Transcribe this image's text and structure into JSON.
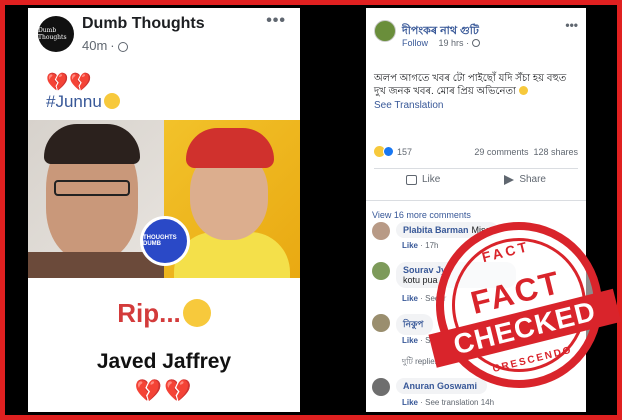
{
  "left_post": {
    "page_name": "Dumb Thoughts",
    "avatar_text": "Dumb Thoughts",
    "time": "40m",
    "more": "•••",
    "emoji_hearts": "💔💔",
    "hashtag": "#Junnu",
    "image_logo_text": "THOUGHTS DUMB",
    "rip_text": "Rip...",
    "person_name": "Javed Jaffrey",
    "bottom_hearts": "💔💔"
  },
  "right_post": {
    "author": "দীপংকৰ নাথ গুটি",
    "follow": "Follow",
    "time": "19 hrs",
    "more": "•••",
    "text": "অলপ আগতে খবৰ টো পাইছোঁ যদি সঁচা হয় বহুত দুখ জনক খবৰ. মোৰ প্ৰিয় অভিনেতা",
    "see_translation": "See Translation",
    "reaction_count": "157",
    "comments_count": "29 comments",
    "shares_count": "128 shares",
    "like_label": "Like",
    "share_label": "Share",
    "view_more": "View 16 more comments",
    "comments": [
      {
        "name": "Plabita Barman",
        "text": "Misa",
        "meta_action": "Like",
        "meta_time": "17h"
      },
      {
        "name": "Sourav Jyo",
        "text": "kotu pua n",
        "meta_action": "Like",
        "meta_extra": "See tr"
      },
      {
        "name": "নিকুপ",
        "text": "",
        "meta_action": "Like",
        "meta_extra": "See tr",
        "reply_text": "দুটি replies"
      },
      {
        "name": "Anuran Goswami",
        "text": "",
        "meta_action": "Like",
        "meta_extra": "See translation",
        "meta_time": "14h"
      }
    ]
  },
  "stamp": {
    "top_text": "FACT",
    "fact": "FACT",
    "checked": "CHECKED",
    "bottom_text": "CRESCENDO"
  }
}
